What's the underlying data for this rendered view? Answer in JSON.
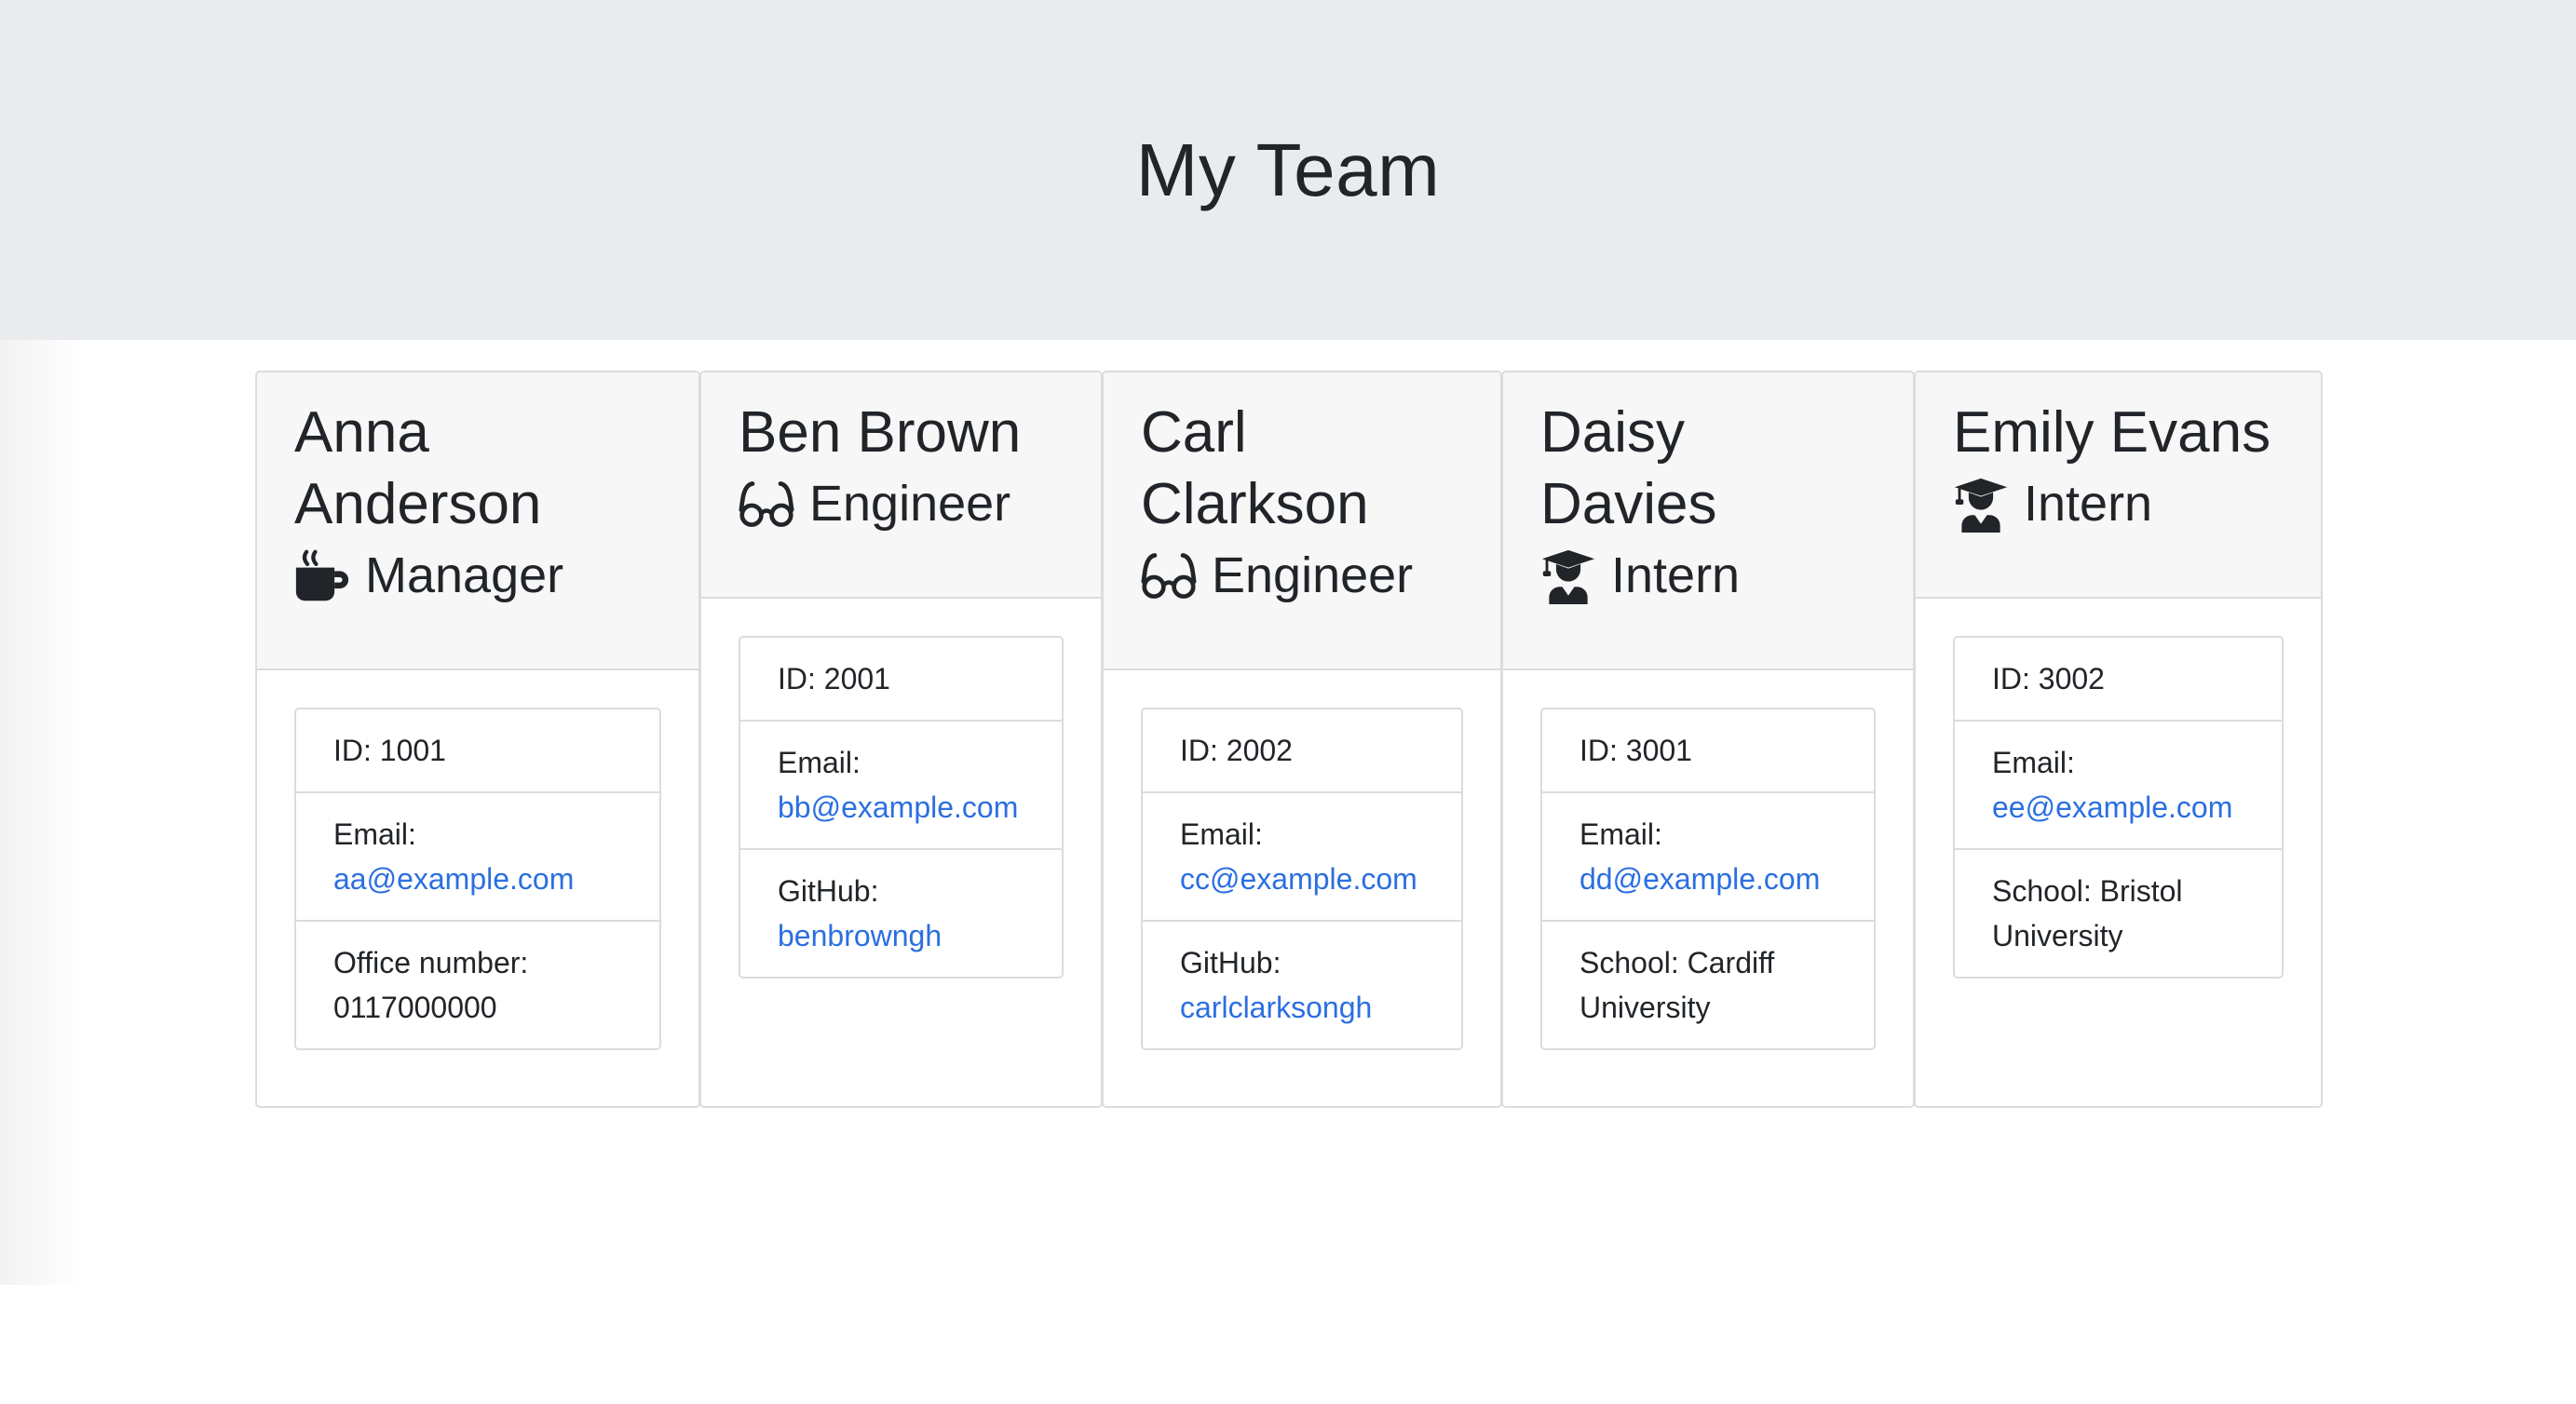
{
  "header": {
    "title": "My Team"
  },
  "employees": [
    {
      "name": "Anna Anderson",
      "role": "Manager",
      "role_icon": "mug-icon",
      "id_text": "ID: 1001",
      "email_label": "Email:",
      "email": "aa@example.com",
      "extra_label": "Office number:",
      "extra_value": "0117000000"
    },
    {
      "name": "Ben Brown",
      "role": "Engineer",
      "role_icon": "glasses-icon",
      "id_text": "ID: 2001",
      "email_label": "Email:",
      "email": "bb@example.com",
      "extra_label": "GitHub:",
      "extra_value": "benbrowngh"
    },
    {
      "name": "Carl Clarkson",
      "role": "Engineer",
      "role_icon": "glasses-icon",
      "id_text": "ID: 2002",
      "email_label": "Email:",
      "email": "cc@example.com",
      "extra_label": "GitHub:",
      "extra_value": "carlclarksongh"
    },
    {
      "name": "Daisy Davies",
      "role": "Intern",
      "role_icon": "graduate-icon",
      "id_text": "ID: 3001",
      "email_label": "Email:",
      "email": "dd@example.com",
      "extra_label": "School:",
      "extra_value": "Cardiff University"
    },
    {
      "name": "Emily Evans",
      "role": "Intern",
      "role_icon": "graduate-icon",
      "id_text": "ID: 3002",
      "email_label": "Email:",
      "email": "ee@example.com",
      "extra_label": "School:",
      "extra_value": "Bristol University"
    }
  ]
}
